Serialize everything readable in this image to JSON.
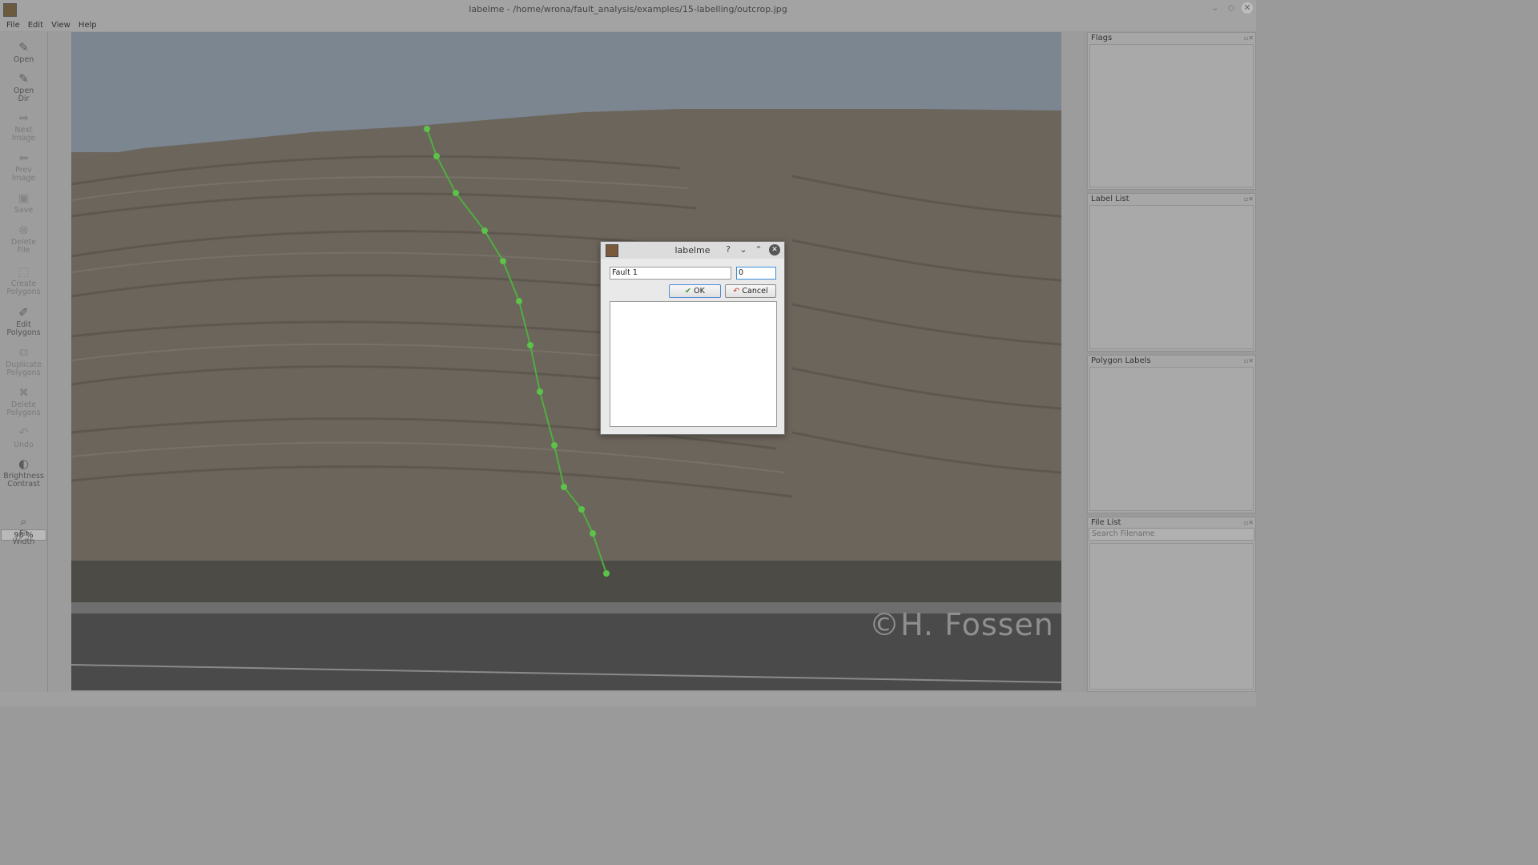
{
  "window": {
    "title": "labelme - /home/wrona/fault_analysis/examples/15-labelling/outcrop.jpg"
  },
  "menu": [
    "File",
    "Edit",
    "View",
    "Help"
  ],
  "toolbar": {
    "open": "Open",
    "open_dir_1": "Open",
    "open_dir_2": "Dir",
    "next_1": "Next",
    "next_2": "Image",
    "prev_1": "Prev",
    "prev_2": "Image",
    "save": "Save",
    "delete_file_1": "Delete",
    "delete_file_2": "File",
    "create_1": "Create",
    "create_2": "Polygons",
    "edit_1": "Edit",
    "edit_2": "Polygons",
    "dup_1": "Duplicate",
    "dup_2": "Polygons",
    "del_poly_1": "Delete",
    "del_poly_2": "Polygons",
    "undo": "Undo",
    "bright_1": "Brightness",
    "bright_2": "Contrast",
    "zoom": "98 %",
    "fit_1": "Fit",
    "fit_2": "Width"
  },
  "docks": {
    "flags": "Flags",
    "label_list": "Label List",
    "polygon_labels": "Polygon Labels",
    "file_list": "File List",
    "search_placeholder": "Search Filename"
  },
  "image": {
    "watermark": "©H. Fossen"
  },
  "dialog": {
    "title": "labelme",
    "label_value": "Fault 1",
    "group_value": "0",
    "ok": "OK",
    "cancel": "Cancel"
  },
  "colors": {
    "polyline": "#4fae3f",
    "vertex": "#5cc24a"
  }
}
